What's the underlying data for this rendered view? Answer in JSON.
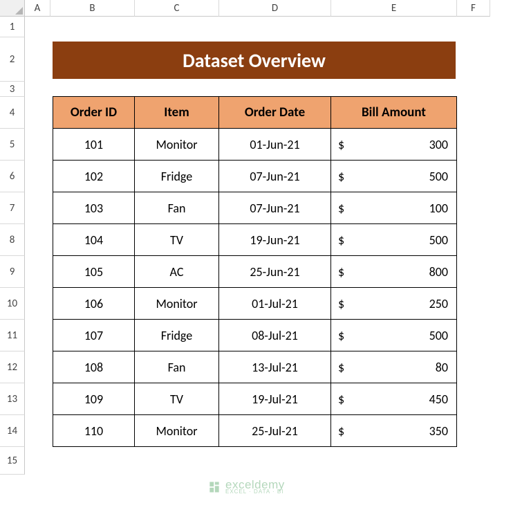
{
  "columns": [
    "A",
    "B",
    "C",
    "D",
    "E",
    "F"
  ],
  "rows": [
    "1",
    "2",
    "3",
    "4",
    "5",
    "6",
    "7",
    "8",
    "9",
    "10",
    "11",
    "12",
    "13",
    "14",
    "15"
  ],
  "title": "Dataset Overview",
  "headers": {
    "orderId": "Order ID",
    "item": "Item",
    "orderDate": "Order Date",
    "billAmount": "Bill Amount"
  },
  "currency": "$",
  "data": [
    {
      "id": "101",
      "item": "Monitor",
      "date": "01-Jun-21",
      "amt": "300"
    },
    {
      "id": "102",
      "item": "Fridge",
      "date": "07-Jun-21",
      "amt": "500"
    },
    {
      "id": "103",
      "item": "Fan",
      "date": "07-Jun-21",
      "amt": "100"
    },
    {
      "id": "104",
      "item": "TV",
      "date": "19-Jun-21",
      "amt": "500"
    },
    {
      "id": "105",
      "item": "AC",
      "date": "25-Jun-21",
      "amt": "800"
    },
    {
      "id": "106",
      "item": "Monitor",
      "date": "01-Jul-21",
      "amt": "250"
    },
    {
      "id": "107",
      "item": "Fridge",
      "date": "08-Jul-21",
      "amt": "500"
    },
    {
      "id": "108",
      "item": "Fan",
      "date": "13-Jul-21",
      "amt": "80"
    },
    {
      "id": "109",
      "item": "TV",
      "date": "19-Jul-21",
      "amt": "450"
    },
    {
      "id": "110",
      "item": "Monitor",
      "date": "25-Jul-21",
      "amt": "350"
    }
  ],
  "watermark": {
    "name": "exceldemy",
    "tagline": "EXCEL · DATA · BI"
  }
}
